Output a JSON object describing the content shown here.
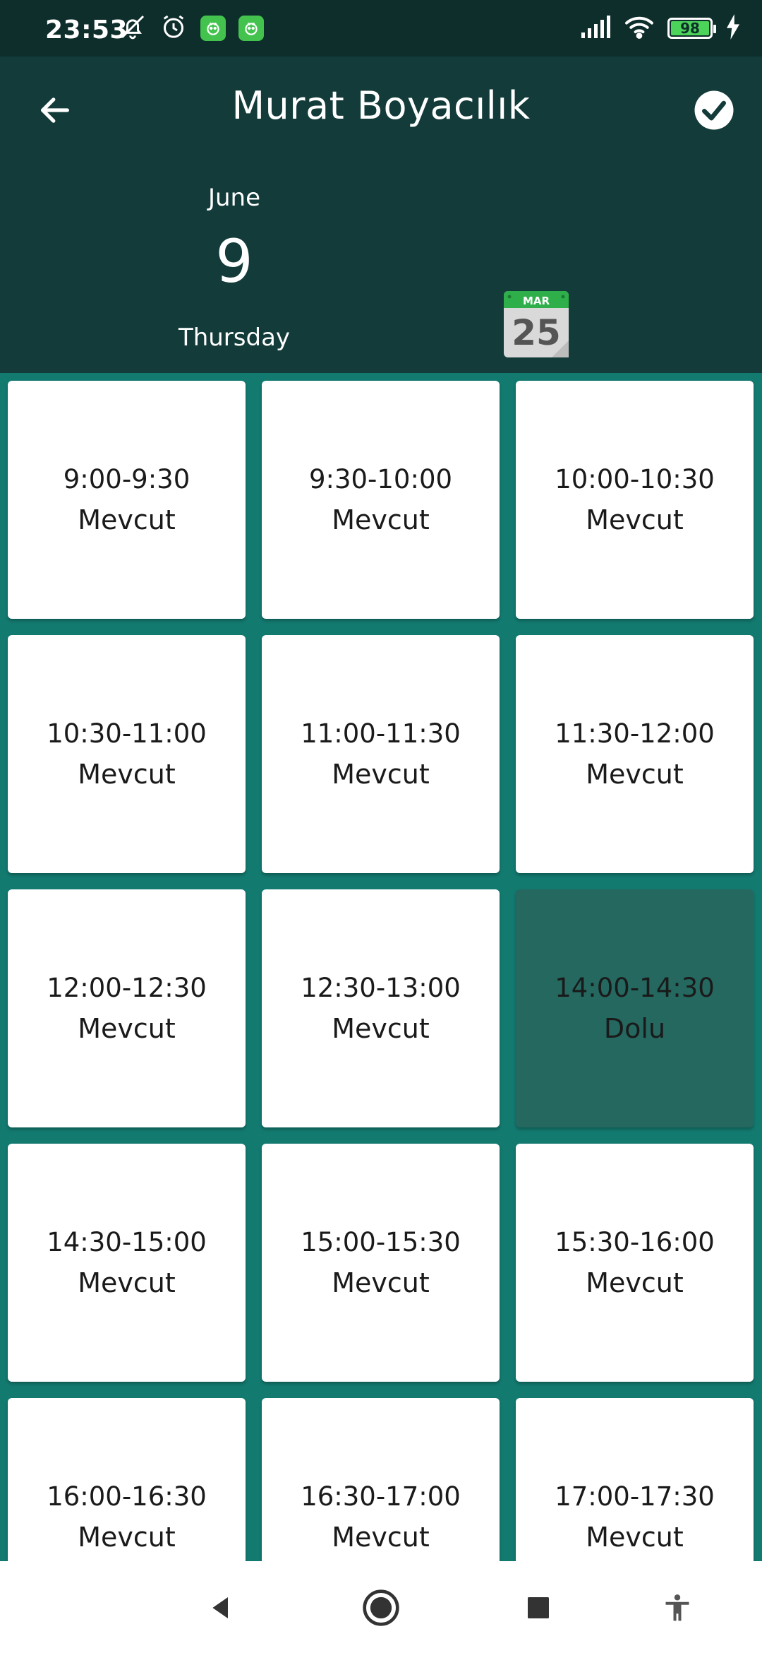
{
  "status_bar": {
    "time": "23:53",
    "battery": "98"
  },
  "header": {
    "title": "Murat Boyacılık",
    "date": {
      "month": "June",
      "day": "9",
      "weekday": "Thursday"
    },
    "calendar_icon": {
      "month": "MAR",
      "day": "25"
    }
  },
  "slots": [
    {
      "time": "9:00-9:30",
      "status": "Mevcut"
    },
    {
      "time": "9:30-10:00",
      "status": "Mevcut"
    },
    {
      "time": "10:00-10:30",
      "status": "Mevcut"
    },
    {
      "time": "10:30-11:00",
      "status": "Mevcut"
    },
    {
      "time": "11:00-11:30",
      "status": "Mevcut"
    },
    {
      "time": "11:30-12:00",
      "status": "Mevcut"
    },
    {
      "time": "12:00-12:30",
      "status": "Mevcut"
    },
    {
      "time": "12:30-13:00",
      "status": "Mevcut"
    },
    {
      "time": "14:00-14:30",
      "status": "Dolu"
    },
    {
      "time": "14:30-15:00",
      "status": "Mevcut"
    },
    {
      "time": "15:00-15:30",
      "status": "Mevcut"
    },
    {
      "time": "15:30-16:00",
      "status": "Mevcut"
    },
    {
      "time": "16:00-16:30",
      "status": "Mevcut"
    },
    {
      "time": "16:30-17:00",
      "status": "Mevcut"
    },
    {
      "time": "17:00-17:30",
      "status": "Mevcut"
    }
  ],
  "colors": {
    "header_bg": "#123B39",
    "status_bar_bg": "#0E2E2B",
    "grid_bg": "#137A70",
    "slot_available": "#FFFFFF",
    "slot_busy": "#256860"
  }
}
